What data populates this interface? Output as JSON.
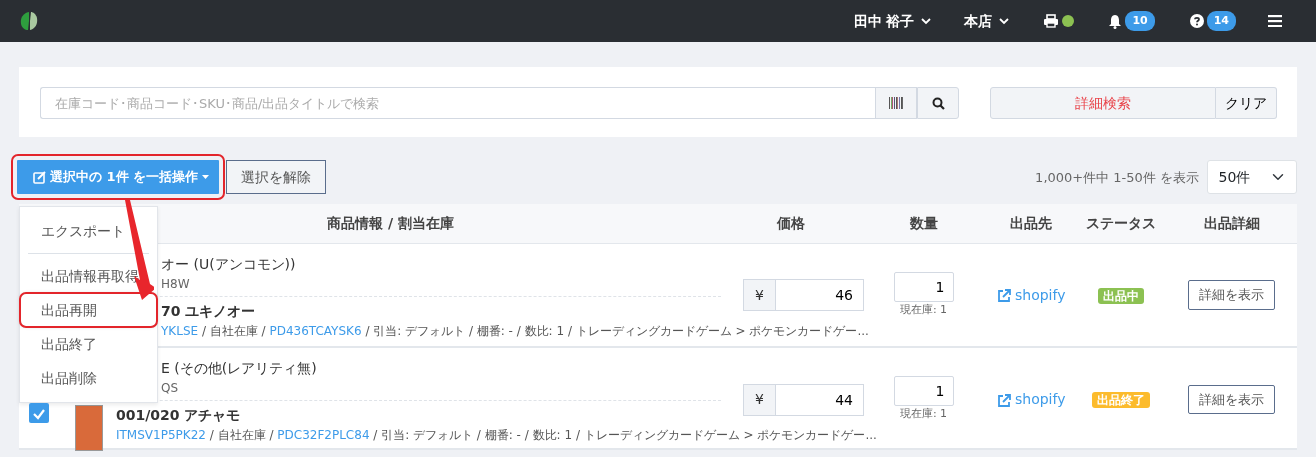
{
  "navbar": {
    "user": "田中 裕子",
    "store": "本店",
    "printer_online": true,
    "notifications": "10",
    "help": "14"
  },
  "search": {
    "placeholder": "在庫コード･商品コード･SKU･商品/出品タイトルで検索",
    "advanced": "詳細検索",
    "clear": "クリア"
  },
  "bulk": {
    "label": "選択中の 1件 を一括操作",
    "highlighted": true,
    "deselect": "選択を解除"
  },
  "menu": {
    "expanded": true,
    "items": [
      {
        "kind": "item",
        "label": "エクスポート",
        "highlighted": false
      },
      {
        "kind": "divider"
      },
      {
        "kind": "item",
        "label": "出品情報再取得",
        "highlighted": false
      },
      {
        "kind": "item",
        "label": "出品再開",
        "highlighted": true
      },
      {
        "kind": "item",
        "label": "出品終了",
        "highlighted": false
      },
      {
        "kind": "item",
        "label": "出品削除",
        "highlighted": false
      }
    ]
  },
  "pagination": {
    "summary": "1,000+件中 1-50件 を表示",
    "per_page": "50件"
  },
  "table": {
    "columns": [
      "商品情報 / 割当在庫",
      "価格",
      "数量",
      "出品先",
      "ステータス",
      "出品詳細"
    ],
    "rows": [
      {
        "listing_title": "オー (U(アンコモン))",
        "listing_code": "H8W",
        "product_name": "70 ユキノオー",
        "meta": [
          {
            "kind": "link",
            "text": "YKLSE"
          },
          {
            "kind": "plain",
            "text": " / 自社在庫 / "
          },
          {
            "kind": "link",
            "text": "PD436TCAYSK6"
          },
          {
            "kind": "plain",
            "text": " / 引当: デフォルト / 棚番: - / 数比: 1 / トレーディングカードゲーム > ポケモンカードゲー..."
          }
        ],
        "currency": "¥",
        "price": "46",
        "quantity": "1",
        "stock": "現在庫: 1",
        "channel": "shopify",
        "status": "出品中",
        "color": "#8cc152",
        "detail": "詳細を表示"
      },
      {
        "checked": true,
        "thumbnail": true,
        "listing_title": "E (その他(レアリティ無)",
        "listing_code": "QS",
        "product_name": "001/020 アチャモ",
        "meta": [
          {
            "kind": "link",
            "text": "ITMSV1P5PK22"
          },
          {
            "kind": "plain",
            "text": " / 自社在庫 / "
          },
          {
            "kind": "link",
            "text": "PDC32F2PLC84"
          },
          {
            "kind": "plain",
            "text": " / 引当: デフォルト / 棚番: - / 数比: 1 / トレーディングカードゲーム > ポケモンカードゲー..."
          }
        ],
        "currency": "¥",
        "price": "44",
        "quantity": "1",
        "stock": "現在庫: 1",
        "channel": "shopify",
        "status": "出品終了",
        "color": "#fcbb2c",
        "detail": "詳細を表示"
      }
    ]
  }
}
